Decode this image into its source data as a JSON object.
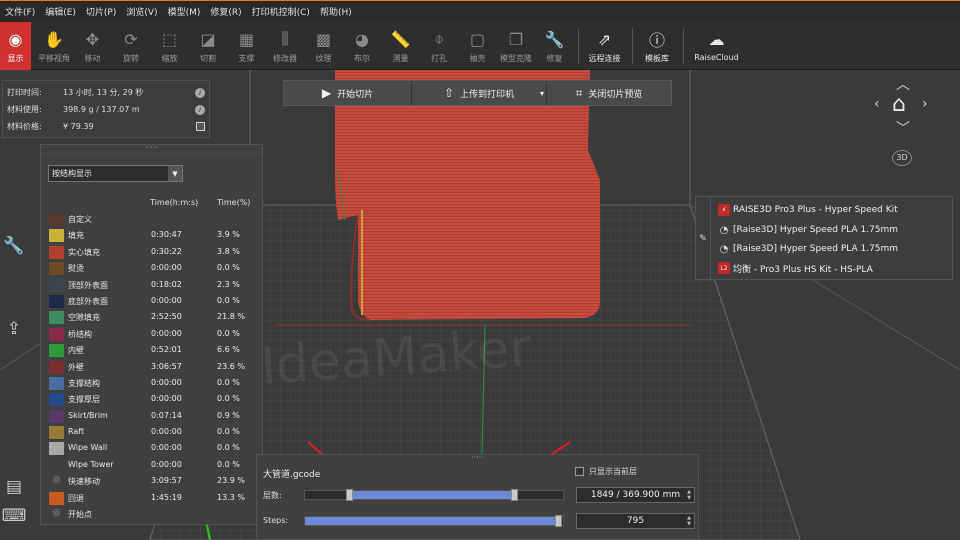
{
  "menu": [
    "文件(F)",
    "编辑(E)",
    "切片(P)",
    "浏览(V)",
    "模型(M)",
    "修复(R)",
    "打印机控制(C)",
    "帮助(H)"
  ],
  "toolbar": [
    {
      "label": "显示",
      "icon": "eye-icon"
    },
    {
      "label": "平移视角",
      "icon": "hand-icon"
    },
    {
      "label": "移动",
      "icon": "move-icon"
    },
    {
      "label": "旋转",
      "icon": "rotate-icon"
    },
    {
      "label": "缩放",
      "icon": "scale-icon"
    },
    {
      "label": "切割",
      "icon": "cut-icon"
    },
    {
      "label": "支撑",
      "icon": "support-icon"
    },
    {
      "label": "修改器",
      "icon": "modifier-icon"
    },
    {
      "label": "纹理",
      "icon": "texture-icon"
    },
    {
      "label": "布尔",
      "icon": "boolean-icon"
    },
    {
      "label": "测量",
      "icon": "measure-icon"
    },
    {
      "label": "打孔",
      "icon": "drill-icon"
    },
    {
      "label": "抽壳",
      "icon": "shell-icon"
    },
    {
      "label": "模型克隆",
      "icon": "clone-icon"
    },
    {
      "label": "修复",
      "icon": "wrench-icon"
    },
    {
      "label": "远程连接",
      "icon": "remote-icon"
    },
    {
      "label": "模板库",
      "icon": "info-icon"
    },
    {
      "label": "RaiseCloud",
      "icon": "cloud-icon"
    }
  ],
  "info": {
    "time_label": "打印时间:",
    "time_value": "13 小时, 13 分, 29 秒",
    "material_label": "材料使用:",
    "material_value": "398.9 g / 137.07 m",
    "price_label": "材料价格:",
    "price_value": "¥ 79.39",
    "info_glyph": "i"
  },
  "top_buttons": {
    "start": "开始切片",
    "upload": "上传到打印机",
    "close": "关闭切片预览"
  },
  "legend": {
    "grip": "·····",
    "display_mode": "按结构显示",
    "col_time": "Time(h:m:s)",
    "col_pct": "Time(%)",
    "rows": [
      {
        "name": "自定义",
        "color": "#5a3a30",
        "time": "",
        "pct": ""
      },
      {
        "name": "填充",
        "color": "#c9b23a",
        "time": "0:30:47",
        "pct": "3.9 %"
      },
      {
        "name": "实心填充",
        "color": "#b0402c",
        "time": "0:30:22",
        "pct": "3.8 %"
      },
      {
        "name": "熨烫",
        "color": "#6e4a28",
        "time": "0:00:00",
        "pct": "0.0 %"
      },
      {
        "name": "顶部外表面",
        "color": "#3c4552",
        "time": "0:18:02",
        "pct": "2.3 %"
      },
      {
        "name": "底部外表面",
        "color": "#1e2848",
        "time": "0:00:00",
        "pct": "0.0 %"
      },
      {
        "name": "空隙填充",
        "color": "#3e8a62",
        "time": "2:52:50",
        "pct": "21.8 %"
      },
      {
        "name": "桥结构",
        "color": "#8a2a4a",
        "time": "0:00:00",
        "pct": "0.0 %"
      },
      {
        "name": "内壁",
        "color": "#2e9a38",
        "time": "0:52:01",
        "pct": "6.6 %"
      },
      {
        "name": "外壁",
        "color": "#7a3030",
        "time": "3:06:57",
        "pct": "23.6 %"
      },
      {
        "name": "支撑结构",
        "color": "#4a6aa0",
        "time": "0:00:00",
        "pct": "0.0 %"
      },
      {
        "name": "支撑厚层",
        "color": "#264a8a",
        "time": "0:00:00",
        "pct": "0.0 %"
      },
      {
        "name": "Skirt/Brim",
        "color": "#5a3a6a",
        "time": "0:07:14",
        "pct": "0.9 %"
      },
      {
        "name": "Raft",
        "color": "#9a7a3a",
        "time": "0:00:00",
        "pct": "0.0 %"
      },
      {
        "name": "Wipe Wall",
        "color": "#a8a8a8",
        "time": "0:00:00",
        "pct": "0.0 %"
      },
      {
        "name": "Wipe Tower",
        "color": "",
        "time": "0:00:00",
        "pct": "0.0 %"
      },
      {
        "name": "快速移动",
        "color": "",
        "eye": true,
        "time": "3:09:57",
        "pct": "23.9 %"
      },
      {
        "name": "回退",
        "color": "#c85a20",
        "time": "1:45:19",
        "pct": "13.3 %"
      },
      {
        "name": "开始点",
        "color": "",
        "eye": true,
        "time": "",
        "pct": ""
      }
    ]
  },
  "materials": {
    "printer": "RAISE3D Pro3 Plus - Hyper Speed Kit",
    "filament1": "[Raise3D] Hyper Speed PLA 1.75mm",
    "filament2": "[Raise3D] Hyper Speed PLA 1.75mm",
    "profile": "均衡 - Pro3 Plus HS Kit - HS-PLA",
    "profile_badge": "L2"
  },
  "layers": {
    "grip": "·····",
    "gcode_name": "大管道.gcode",
    "only_current": "只显示当前层",
    "layers_label": "层数:",
    "layers_value": "1849 / 369.900 mm",
    "layers_low": 0.17,
    "layers_high": 0.81,
    "steps_label": "Steps:",
    "steps_value": "795",
    "steps_fill": 0.98
  },
  "watermark": "IdeaMaker",
  "nav_3d": "3D",
  "colors": {
    "accent": "#d03030",
    "model": "#c64a3e",
    "slider": "#6d8ad8"
  }
}
